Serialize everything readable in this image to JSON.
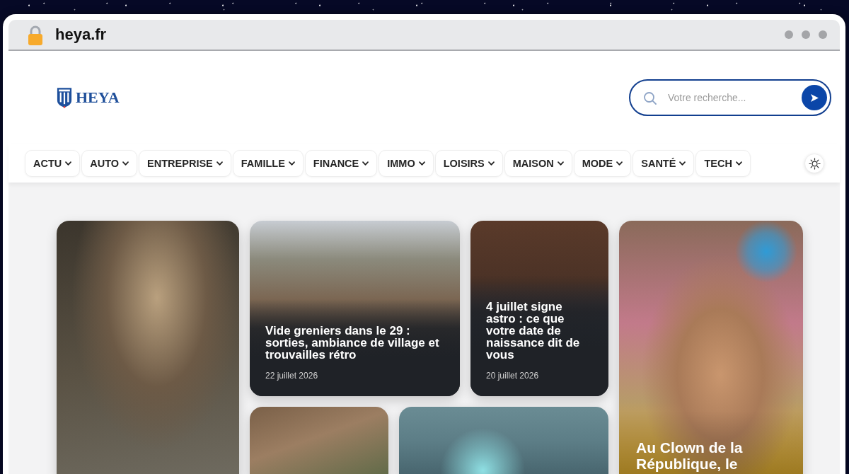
{
  "browser": {
    "url": "heya.fr"
  },
  "header": {
    "logo": "HEYA",
    "search": {
      "placeholder": "Votre recherche..."
    }
  },
  "nav": {
    "items": [
      {
        "label": "ACTU"
      },
      {
        "label": "AUTO"
      },
      {
        "label": "ENTREPRISE"
      },
      {
        "label": "FAMILLE"
      },
      {
        "label": "FINANCE"
      },
      {
        "label": "IMMO"
      },
      {
        "label": "LOISIRS"
      },
      {
        "label": "MAISON"
      },
      {
        "label": "MODE"
      },
      {
        "label": "SANTÉ"
      },
      {
        "label": "TECH"
      }
    ]
  },
  "articles": [
    {
      "kind": "image"
    },
    {
      "kind": "story",
      "title": "Vide greniers dans le 29 : sorties, ambiance de village et trouvailles rétro",
      "date": "22 juillet 2026"
    },
    {
      "kind": "story",
      "title": "4 juillet signe astro : ce que votre date de naissance dit de vous",
      "date": "20 juillet 2026"
    },
    {
      "kind": "story",
      "title": "Au Clown de la République, le"
    },
    {
      "kind": "image"
    },
    {
      "kind": "image"
    }
  ]
}
